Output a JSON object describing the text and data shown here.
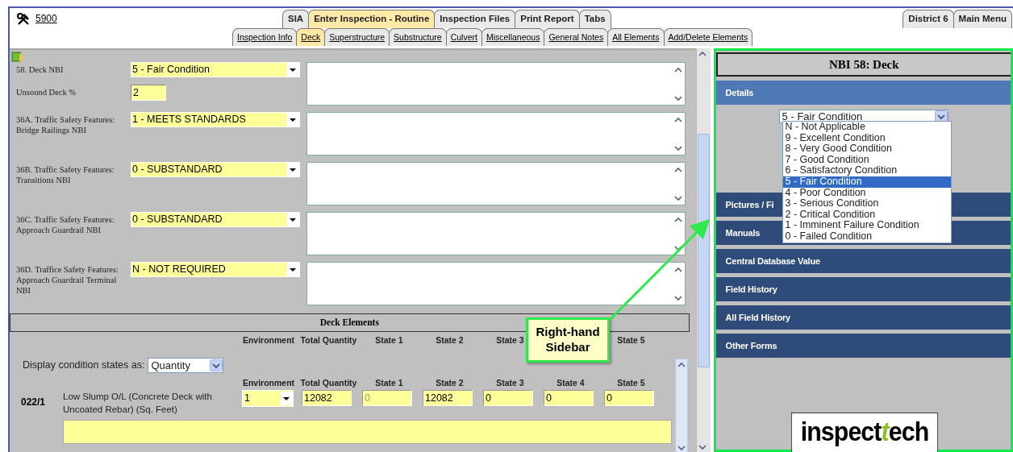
{
  "header": {
    "record_id": "5900",
    "top_tabs": [
      {
        "label": "SIA",
        "selected": false
      },
      {
        "label": "Enter Inspection - Routine",
        "selected": true
      },
      {
        "label": "Inspection Files",
        "selected": false
      },
      {
        "label": "Print Report",
        "selected": false
      },
      {
        "label": "Tabs",
        "selected": false
      }
    ],
    "right_tabs": [
      {
        "label": "District 6",
        "selected": false
      },
      {
        "label": "Main Menu",
        "selected": false
      }
    ],
    "sub_tabs": [
      {
        "label": "Inspection Info",
        "selected": false
      },
      {
        "label": "Deck",
        "selected": true
      },
      {
        "label": "Superstructure",
        "selected": false
      },
      {
        "label": "Substructure",
        "selected": false
      },
      {
        "label": "Culvert",
        "selected": false
      },
      {
        "label": "Miscellaneous",
        "selected": false
      },
      {
        "label": "General Notes",
        "selected": false
      },
      {
        "label": "All Elements",
        "selected": false
      },
      {
        "label": "Add/Delete Elements",
        "selected": false
      }
    ]
  },
  "form": {
    "groups": [
      {
        "fields": [
          {
            "label": "58. Deck NBI",
            "kind": "select",
            "value": "5 - Fair Condition"
          },
          {
            "label": "Unsound Deck %",
            "kind": "input",
            "value": "2"
          }
        ]
      },
      {
        "fields": [
          {
            "label": "36A. Traffic Safety Features: Bridge Railings NBI",
            "kind": "select",
            "value": "1 - MEETS STANDARDS"
          }
        ]
      },
      {
        "fields": [
          {
            "label": "36B. Traffic Safety Features: Transitions NBI",
            "kind": "select",
            "value": "0 - SUBSTANDARD"
          }
        ]
      },
      {
        "fields": [
          {
            "label": "36C. Traffic Safety Features: Approach Guardrail NBI",
            "kind": "select",
            "value": "0 - SUBSTANDARD"
          }
        ]
      },
      {
        "fields": [
          {
            "label": "36D. Traffice Safety Features: Approach Guardrail Terminal NBI",
            "kind": "select",
            "value": "N - NOT REQUIRED"
          }
        ]
      }
    ]
  },
  "deck_elements": {
    "title": "Deck Elements",
    "summary_header": [
      "Environment",
      "Total Quantity",
      "State 1",
      "State 2",
      "State 3",
      "State 5"
    ],
    "display_label": "Display condition states as:",
    "display_value": "Quantity",
    "columns": [
      "Environment",
      "Total Quantity",
      "State 1",
      "State 2",
      "State 3",
      "State 4",
      "State 5"
    ],
    "elements": [
      {
        "code": "022/1",
        "description": "Low Slump O/L (Concrete Deck with Uncoated Rebar)  (Sq. Feet)",
        "environment": "1",
        "total_quantity": "12082",
        "states": [
          {
            "value": "0",
            "disabled": true
          },
          {
            "value": "12082",
            "disabled": false
          },
          {
            "value": "0",
            "disabled": false
          },
          {
            "value": "0",
            "disabled": false
          },
          {
            "value": "0",
            "disabled": false
          }
        ]
      }
    ]
  },
  "sidebar": {
    "title": "NBI 58: Deck",
    "sections": [
      {
        "label": "Details",
        "expanded": true
      },
      {
        "label": "Pictures / Fi",
        "expanded": false
      },
      {
        "label": "Manuals",
        "expanded": false
      },
      {
        "label": "Central Database Value",
        "expanded": false
      },
      {
        "label": "Field History",
        "expanded": false
      },
      {
        "label": "All Field History",
        "expanded": false
      },
      {
        "label": "Other Forms",
        "expanded": false
      }
    ],
    "details_select": {
      "value": "5 - Fair Condition",
      "options": [
        {
          "label": "N - Not Applicable",
          "selected": false
        },
        {
          "label": "9 - Excellent Condition",
          "selected": false
        },
        {
          "label": "8 - Very Good Condition",
          "selected": false
        },
        {
          "label": "7 - Good Condition",
          "selected": false
        },
        {
          "label": "6 - Satisfactory Condition",
          "selected": false
        },
        {
          "label": "5 - Fair Condition",
          "selected": true
        },
        {
          "label": "4 - Poor Condition",
          "selected": false
        },
        {
          "label": "3 - Serious Condition",
          "selected": false
        },
        {
          "label": "2 - Critical Condition",
          "selected": false
        },
        {
          "label": "1 - Imminent Failure Condition",
          "selected": false
        },
        {
          "label": "0 - Failed Condition",
          "selected": false
        }
      ]
    },
    "logo": {
      "main": "inspect",
      "accent": "t",
      "tail": "ech"
    }
  },
  "callout": {
    "text": "Right-hand Sidebar"
  }
}
